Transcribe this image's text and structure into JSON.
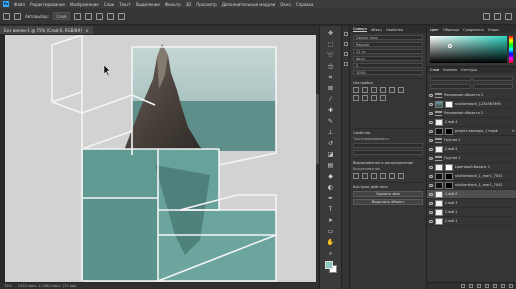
{
  "app": {
    "logo": "Ps"
  },
  "menu": [
    "Файл",
    "Редактирование",
    "Изображение",
    "Слои",
    "Текст",
    "Выделение",
    "Фильтр",
    "3D",
    "Просмотр",
    "Дополнительные модули",
    "Окно",
    "Справка"
  ],
  "options": {
    "autoselect": "Автовыбор:",
    "layer_mode": "Слой"
  },
  "document": {
    "tab_title": "Без имени-1 @ 75% (Слой 6, RGB/8#)",
    "close": "×"
  },
  "status": {
    "zoom": "75%",
    "info": "1920 пикс. x 1080 пикс. (72 ppi)"
  },
  "tools": [
    "move",
    "marquee",
    "lasso",
    "magic-wand",
    "crop",
    "frame",
    "eyedropper",
    "healing",
    "brush",
    "stamp",
    "history-brush",
    "eraser",
    "gradient",
    "blur",
    "dodge",
    "pen",
    "type",
    "path-select",
    "rectangle",
    "hand",
    "zoom"
  ],
  "colors": {
    "foreground": "#8cc8c2",
    "background": "#ffffff",
    "canvas_bg": "#d2d2d2",
    "sea_green": "#5f9a93",
    "accent": "#31a8ff"
  },
  "props_panel": {
    "tabs": [
      "Символ",
      "Абзац",
      "Свойства"
    ],
    "active_tab": "Символ",
    "fields": [
      "DejaVu Sans",
      "Regular",
      "12 пт",
      "Авто",
      "0",
      "100%"
    ],
    "section1": "Настройки",
    "section2": "Свойства",
    "section3": "Выравнивание и распределение",
    "section4": "Быстрые действия",
    "sub1": "Трансформировать",
    "sub2": "Выравнивание",
    "btn1": "Удалить фон",
    "btn2": "Выделить объект"
  },
  "color_panel": {
    "tabs": [
      "Цвет",
      "Образцы",
      "Градиенты",
      "Узоры"
    ],
    "active_tab": "Цвет"
  },
  "layers_panel": {
    "tabs": [
      "Слои",
      "Каналы",
      "Контуры"
    ],
    "active_tab": "Слои",
    "layers": [
      {
        "name": "Рисование объекта 2",
        "thumb": "folder"
      },
      {
        "name": "shutterstock_1234567890",
        "thumb": "img",
        "mask": "white"
      },
      {
        "name": "Рисование объекта 2",
        "thumb": "folder"
      },
      {
        "name": "Слой 4",
        "thumb": "white"
      },
      {
        "name": "project example_1 mask",
        "thumb": "dark",
        "mask": "dark",
        "fx": "fx"
      },
      {
        "name": "Группа 2",
        "thumb": "folder"
      },
      {
        "name": "Слой 5",
        "thumb": "white"
      },
      {
        "name": "Группа 1",
        "thumb": "folder"
      },
      {
        "name": "Цветовой баланс 1",
        "thumb": "white",
        "mask": "white"
      },
      {
        "name": "shutterstock_1_mar1_7041",
        "thumb": "dark",
        "mask": "dark"
      },
      {
        "name": "shutterstock_1_mar1_7042",
        "thumb": "dark",
        "mask": "dark"
      },
      {
        "name": "Слой 6",
        "thumb": "white",
        "active": true
      },
      {
        "name": "Слой 3",
        "thumb": "white"
      },
      {
        "name": "Слой 2",
        "thumb": "white"
      },
      {
        "name": "Слой 1",
        "thumb": "white"
      }
    ]
  }
}
